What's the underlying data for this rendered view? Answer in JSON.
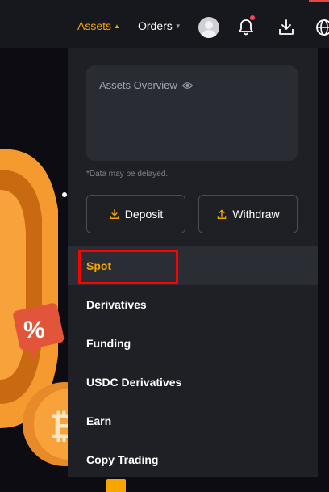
{
  "nav": {
    "assets_label": "Assets",
    "orders_label": "Orders",
    "accent": "#f7a600"
  },
  "icons": {
    "avatar": "user-avatar-icon",
    "bell": "bell-icon",
    "download": "download-icon",
    "globe": "globe-icon",
    "eye": "eye-icon"
  },
  "dropdown": {
    "overview_title": "Assets Overview",
    "note": "*Data may be delayed.",
    "deposit_label": "Deposit",
    "withdraw_label": "Withdraw",
    "items": [
      {
        "label": "Spot"
      },
      {
        "label": "Derivatives"
      },
      {
        "label": "Funding"
      },
      {
        "label": "USDC Derivatives"
      },
      {
        "label": "Earn"
      },
      {
        "label": "Copy Trading"
      }
    ]
  },
  "decoration": {
    "percent_badge": "%"
  }
}
